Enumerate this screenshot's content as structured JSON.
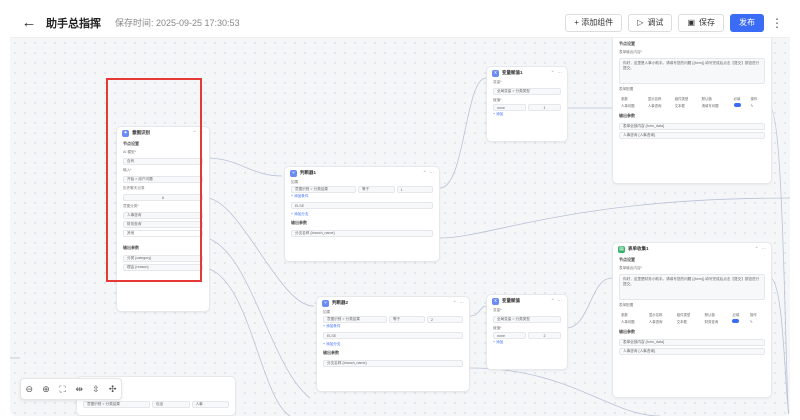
{
  "header": {
    "back_icon": "arrow-left-icon",
    "title": "助手总指挥",
    "saved_time": "保存时间: 2025-09-25 17:30:53",
    "add_component": "+ 添加组件",
    "debug": "调试",
    "save": "保存",
    "publish": "发布"
  },
  "nodes": {
    "intent": {
      "title": "意图识别",
      "section": "节点设置",
      "model_label": "AI 模型*",
      "model_value": "自有",
      "input_label": "输入*",
      "input_value": "开始 > 用户问题",
      "history_label": "历史聊天记录",
      "history_value": "6",
      "options_label": "意图分类*",
      "opt1": "人事咨询",
      "opt2": "财务查询",
      "opt3": "其他",
      "output_label": "输出参数",
      "out1": "分类 {category}",
      "out2": "理由 {reason}"
    },
    "cond1": {
      "title": "判断器1",
      "if": "如果",
      "var": "意图识别 > 分类结果",
      "op": "等于",
      "val": "1",
      "add": "+ 添加条件",
      "else": "ELSE",
      "add_branch": "+ 添加分支",
      "output_label": "输出参数",
      "out": "分支名称 {branch_name}"
    },
    "cond2": {
      "title": "判断器2",
      "if": "如果",
      "var": "意图识别 > 分类结果",
      "op": "等于",
      "val": "2",
      "add": "+ 添加条件",
      "else": "ELSE",
      "add_branch": "+ 添加分支",
      "output_label": "输出参数",
      "out": "分支名称 {branch_name}"
    },
    "assign1": {
      "title": "变量赋值1",
      "var_label": "变量*",
      "var_value": "全局变量 > 分类类型",
      "val_label": "赋值*",
      "mode": "none",
      "num": "1",
      "add": "+ 添加"
    },
    "assign2": {
      "title": "变量赋值",
      "var_label": "变量*",
      "var_value": "全局变量 > 分类类型",
      "val_label": "赋值*",
      "mode": "none",
      "num": "2",
      "add": "+ 添加"
    },
    "form1": {
      "section": "节点设置",
      "prompt_label": "表单输出内容*",
      "prompt_text": "你好，这里是人事小助手。请填写您的问题 {{form}} 填写完成后点击【提交】按钮进行提交。",
      "table_label": "表单配置",
      "cols": [
        "参数",
        "显示名称",
        "组件类型",
        "默认值",
        "必填",
        "操作"
      ],
      "row": [
        "人事问题",
        "人事咨询",
        "文本框",
        "请填写问题"
      ],
      "output_label": "输出参数",
      "out1": "表单全部内容 {form_data}",
      "out2": "人事咨询 {人事咨询}"
    },
    "form2": {
      "title": "表单收集1",
      "section": "节点设置",
      "prompt_label": "表单输出内容*",
      "prompt_text": "你好，这里是财务小助手。请填写您的问题 {{form}} 填写完成后点击【提交】按钮进行提交。",
      "table_label": "表单配置",
      "cols": [
        "参数",
        "显示名称",
        "组件类型",
        "默认值",
        "必填",
        "操作"
      ],
      "row": [
        "人事问题",
        "人事咨询",
        "文本框",
        "财务查询"
      ],
      "output_label": "输出参数",
      "out1": "表单全部内容 {form_data}",
      "out2": "人事咨询 {人事咨询}"
    },
    "bottom": {
      "var": "意图识别 > 分类结果",
      "op": "包含",
      "val": "人事"
    }
  },
  "zoom": {
    "zoom_out": "zoom-out-icon",
    "zoom_in": "zoom-in-icon",
    "fit": "fit-view-icon",
    "align_h": "align-horizontal-icon",
    "align_v": "align-vertical-icon",
    "layout": "auto-layout-icon"
  },
  "colors": {
    "accent": "#3b6cf6",
    "highlight": "#e53935"
  }
}
